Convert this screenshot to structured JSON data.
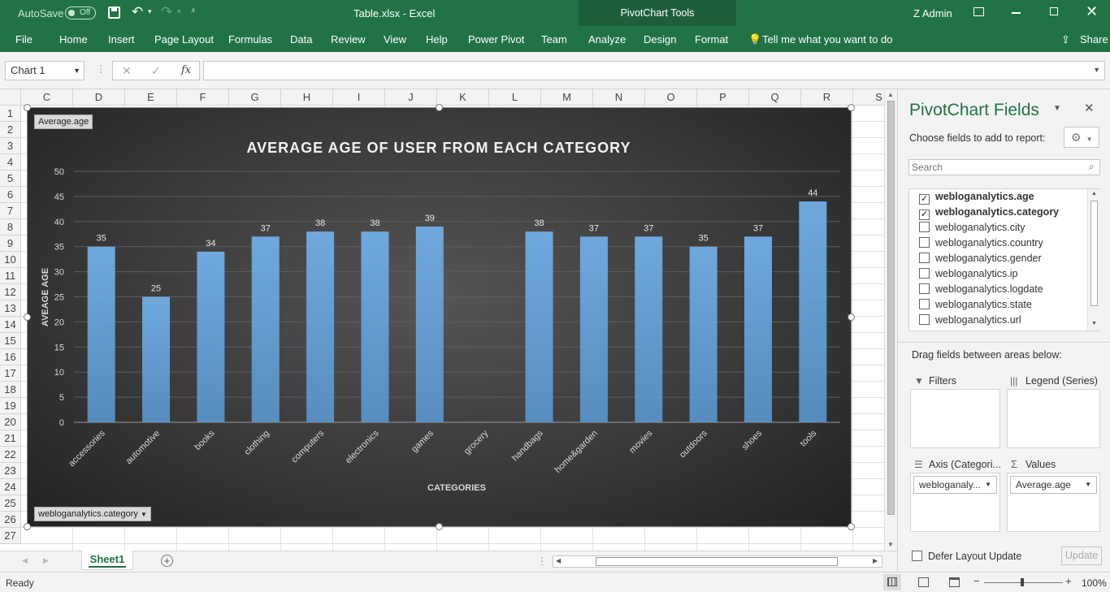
{
  "titlebar": {
    "autosave": "AutoSave",
    "autosave_state": "Off",
    "title": "Table.xlsx  -  Excel",
    "context_tools": "PivotChart Tools",
    "user": "Z Admin"
  },
  "ribbon": {
    "tabs": [
      "File",
      "Home",
      "Insert",
      "Page Layout",
      "Formulas",
      "Data",
      "Review",
      "View",
      "Help",
      "Power Pivot",
      "Team",
      "Analyze",
      "Design",
      "Format"
    ],
    "tell_me": "Tell me what you want to do",
    "share": "Share"
  },
  "formula_bar": {
    "name_box": "Chart 1",
    "fx": "fx",
    "content": ""
  },
  "columns": [
    "C",
    "D",
    "E",
    "F",
    "G",
    "H",
    "I",
    "J",
    "K",
    "L",
    "M",
    "N",
    "O",
    "P",
    "Q",
    "R",
    "S"
  ],
  "rows": [
    "1",
    "2",
    "3",
    "4",
    "5",
    "6",
    "7",
    "8",
    "9",
    "10",
    "11",
    "12",
    "13",
    "14",
    "15",
    "16",
    "17",
    "18",
    "19",
    "20",
    "21",
    "22",
    "23",
    "24",
    "25",
    "26",
    "27"
  ],
  "chart_data": {
    "type": "bar",
    "title": "AVERAGE AGE OF USER FROM EACH CATEGORY",
    "xlabel": "CATEGORIES",
    "ylabel": "AVEAGE AGE",
    "ylim": [
      0,
      50
    ],
    "yticks": [
      0,
      5,
      10,
      15,
      20,
      25,
      30,
      35,
      40,
      45,
      50
    ],
    "categories": [
      "accessories",
      "automotive",
      "books",
      "clothing",
      "computers",
      "electronics",
      "games",
      "grocery",
      "handbags",
      "home&garden",
      "movies",
      "outdoors",
      "shoes",
      "tools"
    ],
    "values": [
      35,
      25,
      34,
      37,
      38,
      38,
      39,
      null,
      38,
      37,
      37,
      35,
      37,
      44
    ],
    "value_field_button": "Average.age",
    "axis_field_button": "webloganalytics.category",
    "bar_color": "#5b9bd5",
    "grid": true
  },
  "panel": {
    "title": "PivotChart Fields",
    "choose": "Choose fields to add to report:",
    "search_placeholder": "Search",
    "fields": [
      {
        "name": "webloganalytics.age",
        "checked": true
      },
      {
        "name": "webloganalytics.category",
        "checked": true
      },
      {
        "name": "webloganalytics.city",
        "checked": false
      },
      {
        "name": "webloganalytics.country",
        "checked": false
      },
      {
        "name": "webloganalytics.gender",
        "checked": false
      },
      {
        "name": "webloganalytics.ip",
        "checked": false
      },
      {
        "name": "webloganalytics.logdate",
        "checked": false
      },
      {
        "name": "webloganalytics.state",
        "checked": false
      },
      {
        "name": "webloganalytics.url",
        "checked": false
      }
    ],
    "drag_text": "Drag fields between areas below:",
    "filters": "Filters",
    "legend": "Legend (Series)",
    "axis": "Axis (Categori...",
    "values": "Values",
    "axis_item": "webloganaly...",
    "values_item": "Average.age",
    "defer": "Defer Layout Update",
    "update": "Update"
  },
  "sheet": {
    "tab": "Sheet1"
  },
  "status": {
    "ready": "Ready",
    "zoom": "100%"
  }
}
